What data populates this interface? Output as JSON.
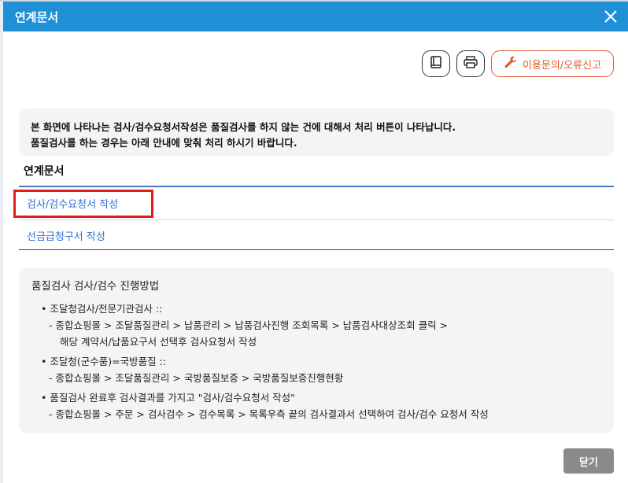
{
  "dialog": {
    "title": "연계문서",
    "close_label": "닫기"
  },
  "toolbar": {
    "manual_icon": "book-icon",
    "print_icon": "printer-icon",
    "report_label": "이용문의/오류신고",
    "report_icon": "wrench-icon",
    "accent_color": "#e05a2a"
  },
  "notice": {
    "line1": "본 화면에 나타나는 검사/검수요청서작성은 품질검사를 하지 않는 건에 대해서 처리 버튼이 나타납니다.",
    "line2": "품질검사를 하는 경우는 아래 안내에 맞춰 처리 하시기 바랍니다."
  },
  "section": {
    "title": "연계문서",
    "links": [
      {
        "label": "검사/검수요청서 작성"
      },
      {
        "label": "선금급청구서 작성"
      }
    ]
  },
  "guide": {
    "title": "품질검사 검사/검수 진행방법",
    "items": [
      {
        "heading": "• 조달청검사/전문기관검사 ::",
        "line1": "- 종합쇼핑몰 > 조달품질관리 > 납품관리 > 납품검사진행 조회목록 > 납품검사대상조회 클릭 >",
        "line2": "해당 계약서/납품요구서 선택후 검사요청서 작성"
      },
      {
        "heading": "• 조달청(군수품)=국방품질 ::",
        "line1": "- 종합쇼핑몰 > 조달품질관리 > 국방품질보증 > 국방품질보증진행현황"
      },
      {
        "heading": "• 품질검사 완료후 검사결과를 가지고 \"검사/검수요청서 작성\"",
        "line1": "- 종합쇼핑몰 > 주문 > 검사검수 > 검수목록 > 목록우측 끝의 검사결과서 선택하여 검사/검수 요청서 작성"
      }
    ]
  },
  "colors": {
    "titlebar": "#1f8fd6",
    "link": "#2f6fd6",
    "highlight": "#e01b1b"
  }
}
